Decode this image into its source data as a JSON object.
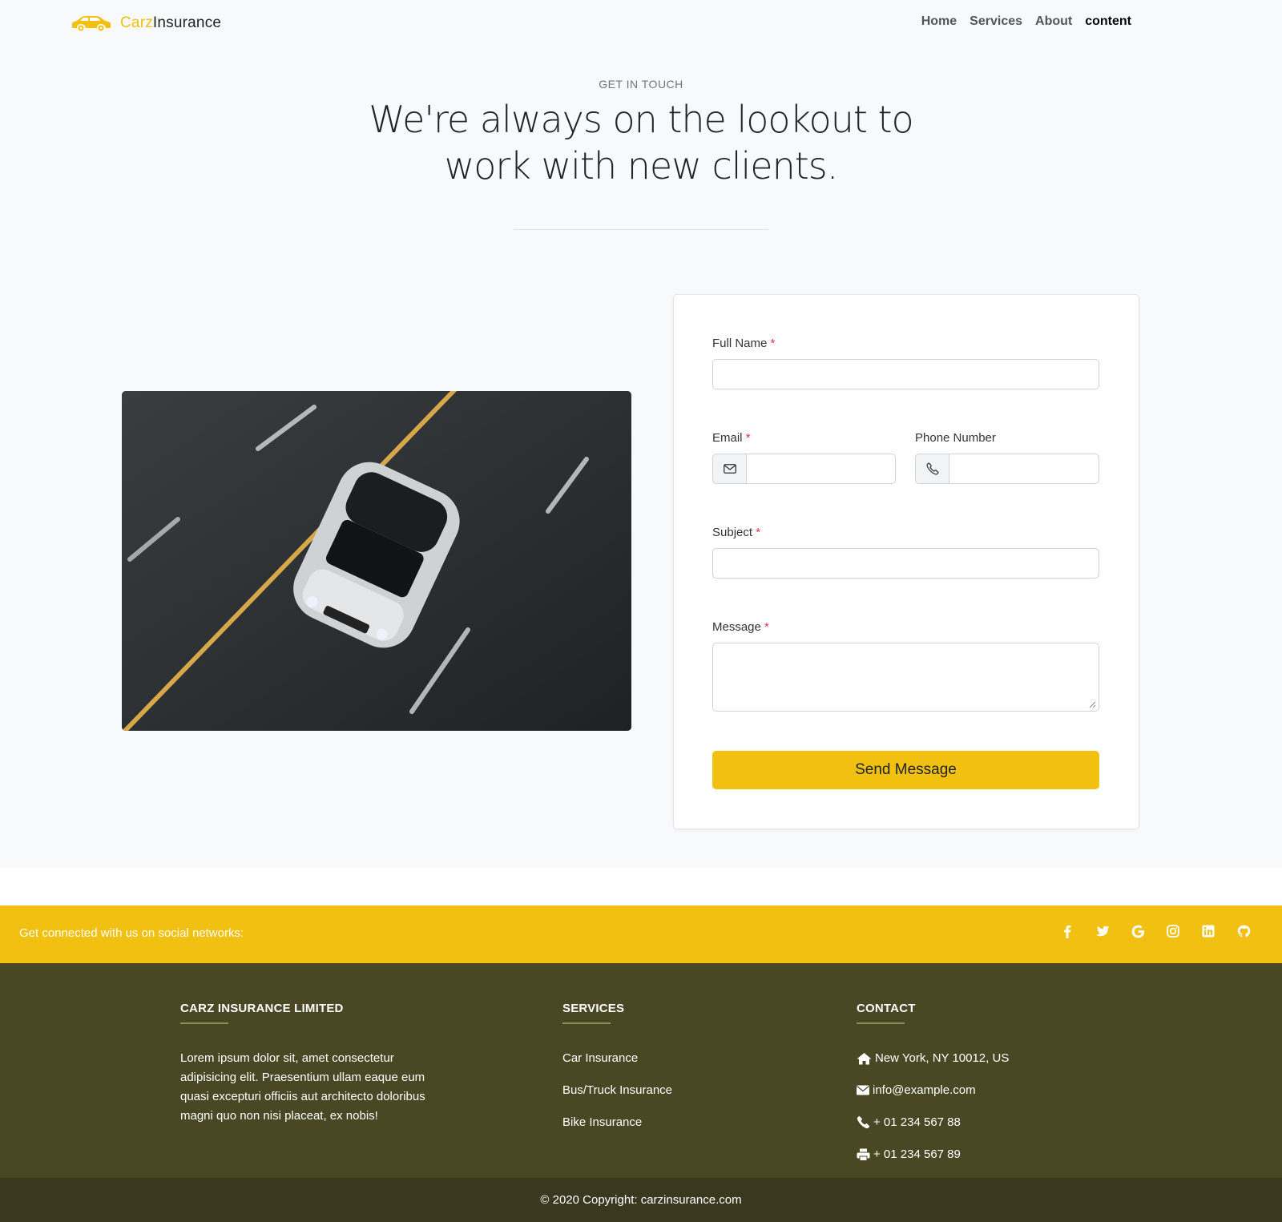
{
  "brand": {
    "part1": "Carz",
    "part2": "Insurance",
    "accent": "#f2c011"
  },
  "nav": {
    "items": [
      "Home",
      "Services",
      "About",
      "content"
    ]
  },
  "hero": {
    "eyebrow": "GET IN TOUCH",
    "headline_line1": "We're always on the lookout to",
    "headline_line2": "work with new clients."
  },
  "form": {
    "full_name_label": "Full Name",
    "email_label": "Email",
    "phone_label": "Phone Number",
    "subject_label": "Subject",
    "message_label": "Message",
    "required_mark": "*",
    "submit_label": "Send Message",
    "email_icon": "envelope-icon",
    "phone_icon": "phone-icon"
  },
  "social": {
    "text": "Get connected with us on social networks:",
    "icons": [
      "facebook-icon",
      "twitter-icon",
      "google-icon",
      "instagram-icon",
      "linkedin-icon",
      "github-icon"
    ]
  },
  "footer": {
    "company_heading": "CARZ INSURANCE LIMITED",
    "company_text": "Lorem ipsum dolor sit, amet consectetur adipisicing elit. Praesentium ullam eaque eum quasi excepturi officiis aut architecto doloribus magni quo non nisi placeat, ex nobis!",
    "services_heading": "SERVICES",
    "services": [
      "Car Insurance",
      "Bus/Truck Insurance",
      "Bike Insurance"
    ],
    "contact_heading": "CONTACT",
    "contact": {
      "address": "New York, NY 10012, US",
      "email": "info@example.com",
      "phone": "+ 01 234 567 88",
      "fax": "+ 01 234 567 89"
    },
    "copyright": "© 2020 Copyright: carzinsurance.com"
  },
  "colors": {
    "footer_bg": "#4a4824",
    "copyright_bg": "#3a3920",
    "accent": "#f2c011"
  }
}
